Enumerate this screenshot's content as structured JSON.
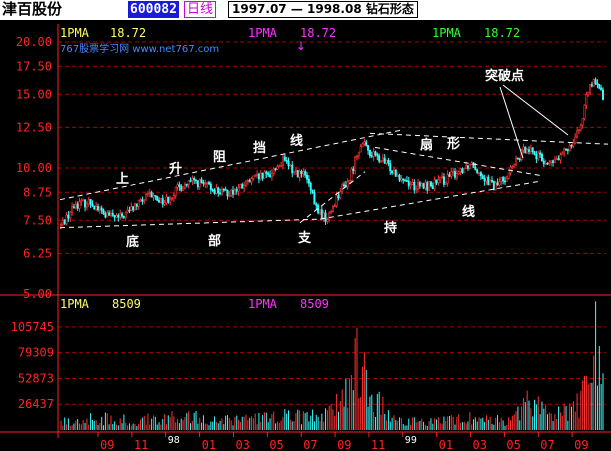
{
  "header": {
    "stock_name": "津百股份",
    "stock_code": "600082",
    "period": "日线",
    "range_label": "1997.07 — 1998.08 钻石形态"
  },
  "price_panel": {
    "ma_items": [
      {
        "label": "1PMA",
        "value": "18.72",
        "color": "#ffff66"
      },
      {
        "label": "1PMA",
        "value": "18.72",
        "color": "#ff33ff"
      },
      {
        "label": "1PMA",
        "value": "18.72",
        "color": "#33ff33"
      }
    ],
    "watermark": "767股票学习网 www.net767.com",
    "marker": "↓"
  },
  "volume_panel": {
    "ma_items": [
      {
        "label": "1PMA",
        "value": "8509",
        "color": "#ffff66"
      },
      {
        "label": "1PMA",
        "value": "8509",
        "color": "#ff33ff"
      }
    ]
  },
  "annotations": [
    {
      "id": "shang",
      "text": "上"
    },
    {
      "id": "sheng",
      "text": "升"
    },
    {
      "id": "zu",
      "text": "阻"
    },
    {
      "id": "dang",
      "text": "挡"
    },
    {
      "id": "xian-top",
      "text": "线"
    },
    {
      "id": "di",
      "text": "底"
    },
    {
      "id": "bu",
      "text": "部"
    },
    {
      "id": "zhi",
      "text": "支"
    },
    {
      "id": "chi",
      "text": "持"
    },
    {
      "id": "xian-bottom",
      "text": "线"
    },
    {
      "id": "shan",
      "text": "扇"
    },
    {
      "id": "xing",
      "text": "形"
    },
    {
      "id": "breakout",
      "text": "突破点"
    }
  ],
  "colors": {
    "up": "#ff3333",
    "down": "#33ffff",
    "grid": "#aa0000",
    "axis": "#ff2222",
    "label": "#ffffff"
  },
  "chart_data": [
    {
      "type": "candlestick",
      "title": "",
      "y_ticks": [
        5.0,
        6.25,
        7.5,
        8.75,
        10.0,
        12.5,
        15.0,
        17.5,
        20.0
      ],
      "ylim": [
        5.0,
        20.0
      ],
      "scale": "log",
      "grid": true,
      "price_path": [
        {
          "x": 0,
          "close": 7.3
        },
        {
          "x": 8,
          "close": 8.2
        },
        {
          "x": 16,
          "close": 8.3
        },
        {
          "x": 24,
          "close": 7.7
        },
        {
          "x": 32,
          "close": 7.6
        },
        {
          "x": 40,
          "close": 8.1
        },
        {
          "x": 48,
          "close": 8.6
        },
        {
          "x": 56,
          "close": 8.3
        },
        {
          "x": 64,
          "close": 9.0
        },
        {
          "x": 72,
          "close": 9.3
        },
        {
          "x": 80,
          "close": 9.0
        },
        {
          "x": 88,
          "close": 8.7
        },
        {
          "x": 96,
          "close": 8.9
        },
        {
          "x": 104,
          "close": 9.4
        },
        {
          "x": 112,
          "close": 9.6
        },
        {
          "x": 120,
          "close": 10.4
        },
        {
          "x": 126,
          "close": 9.8
        },
        {
          "x": 132,
          "close": 9.6
        },
        {
          "x": 138,
          "close": 8.0
        },
        {
          "x": 144,
          "close": 7.5
        },
        {
          "x": 150,
          "close": 8.7
        },
        {
          "x": 156,
          "close": 9.4
        },
        {
          "x": 162,
          "close": 11.5
        },
        {
          "x": 168,
          "close": 10.8
        },
        {
          "x": 176,
          "close": 10.2
        },
        {
          "x": 184,
          "close": 9.5
        },
        {
          "x": 192,
          "close": 9.0
        },
        {
          "x": 200,
          "close": 9.1
        },
        {
          "x": 208,
          "close": 9.4
        },
        {
          "x": 216,
          "close": 9.9
        },
        {
          "x": 222,
          "close": 10.3
        },
        {
          "x": 228,
          "close": 9.6
        },
        {
          "x": 234,
          "close": 9.0
        },
        {
          "x": 240,
          "close": 9.5
        },
        {
          "x": 246,
          "close": 10.3
        },
        {
          "x": 252,
          "close": 11.3
        },
        {
          "x": 258,
          "close": 10.6
        },
        {
          "x": 264,
          "close": 10.2
        },
        {
          "x": 270,
          "close": 10.6
        },
        {
          "x": 276,
          "close": 11.5
        },
        {
          "x": 282,
          "close": 13.0
        },
        {
          "x": 286,
          "close": 16.2
        },
        {
          "x": 290,
          "close": 15.6
        },
        {
          "x": 293,
          "close": 14.8
        }
      ],
      "volume_ticks": [
        26437,
        52873,
        79309,
        105745
      ],
      "volume_path": [
        {
          "x": 0,
          "v": 9000
        },
        {
          "x": 20,
          "v": 14000
        },
        {
          "x": 40,
          "v": 11000
        },
        {
          "x": 60,
          "v": 18000
        },
        {
          "x": 80,
          "v": 13000
        },
        {
          "x": 100,
          "v": 12000
        },
        {
          "x": 120,
          "v": 17000
        },
        {
          "x": 140,
          "v": 16000
        },
        {
          "x": 150,
          "v": 30000
        },
        {
          "x": 162,
          "v": 90000
        },
        {
          "x": 166,
          "v": 45000
        },
        {
          "x": 180,
          "v": 12000
        },
        {
          "x": 200,
          "v": 9000
        },
        {
          "x": 220,
          "v": 14000
        },
        {
          "x": 240,
          "v": 11000
        },
        {
          "x": 255,
          "v": 35000
        },
        {
          "x": 265,
          "v": 18000
        },
        {
          "x": 280,
          "v": 30000
        },
        {
          "x": 286,
          "v": 70000
        },
        {
          "x": 289,
          "v": 102000
        },
        {
          "x": 293,
          "v": 45000
        }
      ],
      "x_ticks": [
        "09",
        "11",
        "98",
        "01",
        "03",
        "05",
        "07",
        "09",
        "11",
        "99",
        "01",
        "03",
        "05",
        "07",
        "09"
      ]
    }
  ]
}
